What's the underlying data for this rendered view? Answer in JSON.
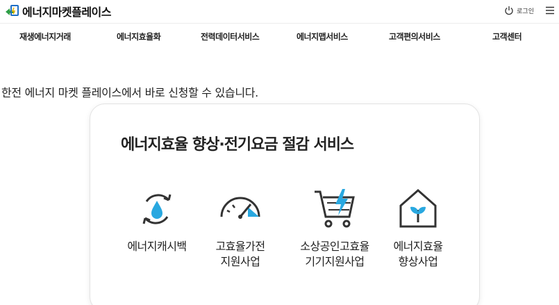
{
  "header": {
    "logo_text": "에너지마켓플레이스",
    "login_label": "로그인"
  },
  "nav": {
    "items": [
      {
        "label": "재생에너지거래"
      },
      {
        "label": "에너지효율화"
      },
      {
        "label": "전력데이터서비스"
      },
      {
        "label": "에너지맵서비스"
      },
      {
        "label": "고객편의서비스"
      },
      {
        "label": "고객센터"
      }
    ]
  },
  "intro": {
    "text": "한전 에너지 마켓 플레이스에서 바로 신청할 수 있습니다."
  },
  "card": {
    "title": "에너지효율 향상·전기요금 절감 서비스",
    "services": [
      {
        "label": "에너지캐시백",
        "icon": "water-drop-cycle-icon"
      },
      {
        "label": "고효율가전\n지원사업",
        "icon": "gauge-icon"
      },
      {
        "label": "소상공인고효율\n기기지원사업",
        "icon": "cart-lightning-icon"
      },
      {
        "label": "에너지효율\n향상사업",
        "icon": "house-sprout-icon"
      }
    ]
  },
  "colors": {
    "accent_blue": "#29a8e0",
    "icon_dark": "#333333",
    "logo_green": "#2e9e48",
    "logo_blue": "#1f6fc5"
  }
}
